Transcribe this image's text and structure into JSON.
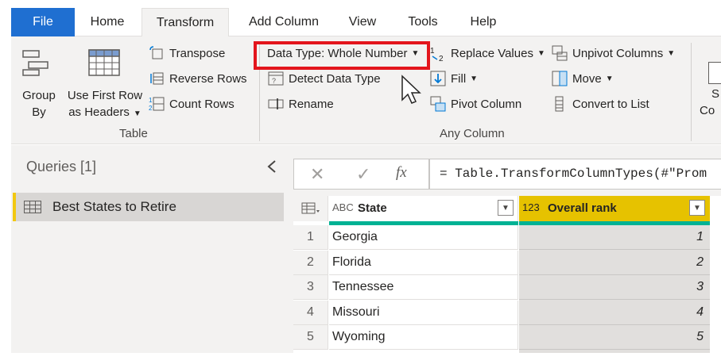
{
  "tabs": [
    "File",
    "Home",
    "Transform",
    "Add Column",
    "View",
    "Tools",
    "Help"
  ],
  "ribbon": {
    "table_group": {
      "group_by": [
        "Group",
        "By"
      ],
      "use_first_row": [
        "Use First Row",
        "as Headers"
      ],
      "transpose": "Transpose",
      "reverse_rows": "Reverse Rows",
      "count_rows": "Count Rows",
      "label": "Table"
    },
    "any_column_group": {
      "data_type": "Data Type: Whole Number",
      "detect_data_type": "Detect Data Type",
      "rename": "Rename",
      "replace_values": "Replace Values",
      "fill": "Fill",
      "pivot_column": "Pivot Column",
      "unpivot_columns": "Unpivot Columns",
      "move": "Move",
      "convert_to_list": "Convert to List",
      "label": "Any Column"
    },
    "partial": [
      "S",
      "Co"
    ]
  },
  "queries": {
    "title": "Queries [1]",
    "items": [
      "Best States to Retire"
    ]
  },
  "formula": {
    "cancel": "✕",
    "confirm": "✓",
    "fx": "fx",
    "text": "= Table.TransformColumnTypes(#\"Prom"
  },
  "grid": {
    "columns": [
      {
        "type_icon": "ABC",
        "name": "State"
      },
      {
        "type_icon": "123",
        "name": "Overall rank"
      }
    ],
    "rows": [
      {
        "index": "1",
        "state": "Georgia",
        "rank": "1"
      },
      {
        "index": "2",
        "state": "Florida",
        "rank": "2"
      },
      {
        "index": "3",
        "state": "Tennessee",
        "rank": "3"
      },
      {
        "index": "4",
        "state": "Missouri",
        "rank": "4"
      },
      {
        "index": "5",
        "state": "Wyoming",
        "rank": "5"
      }
    ]
  },
  "colors": {
    "accent": "#1f6fd1",
    "highlight": "#e3151c",
    "selected_col": "#e6c200",
    "teal": "#00b294"
  }
}
